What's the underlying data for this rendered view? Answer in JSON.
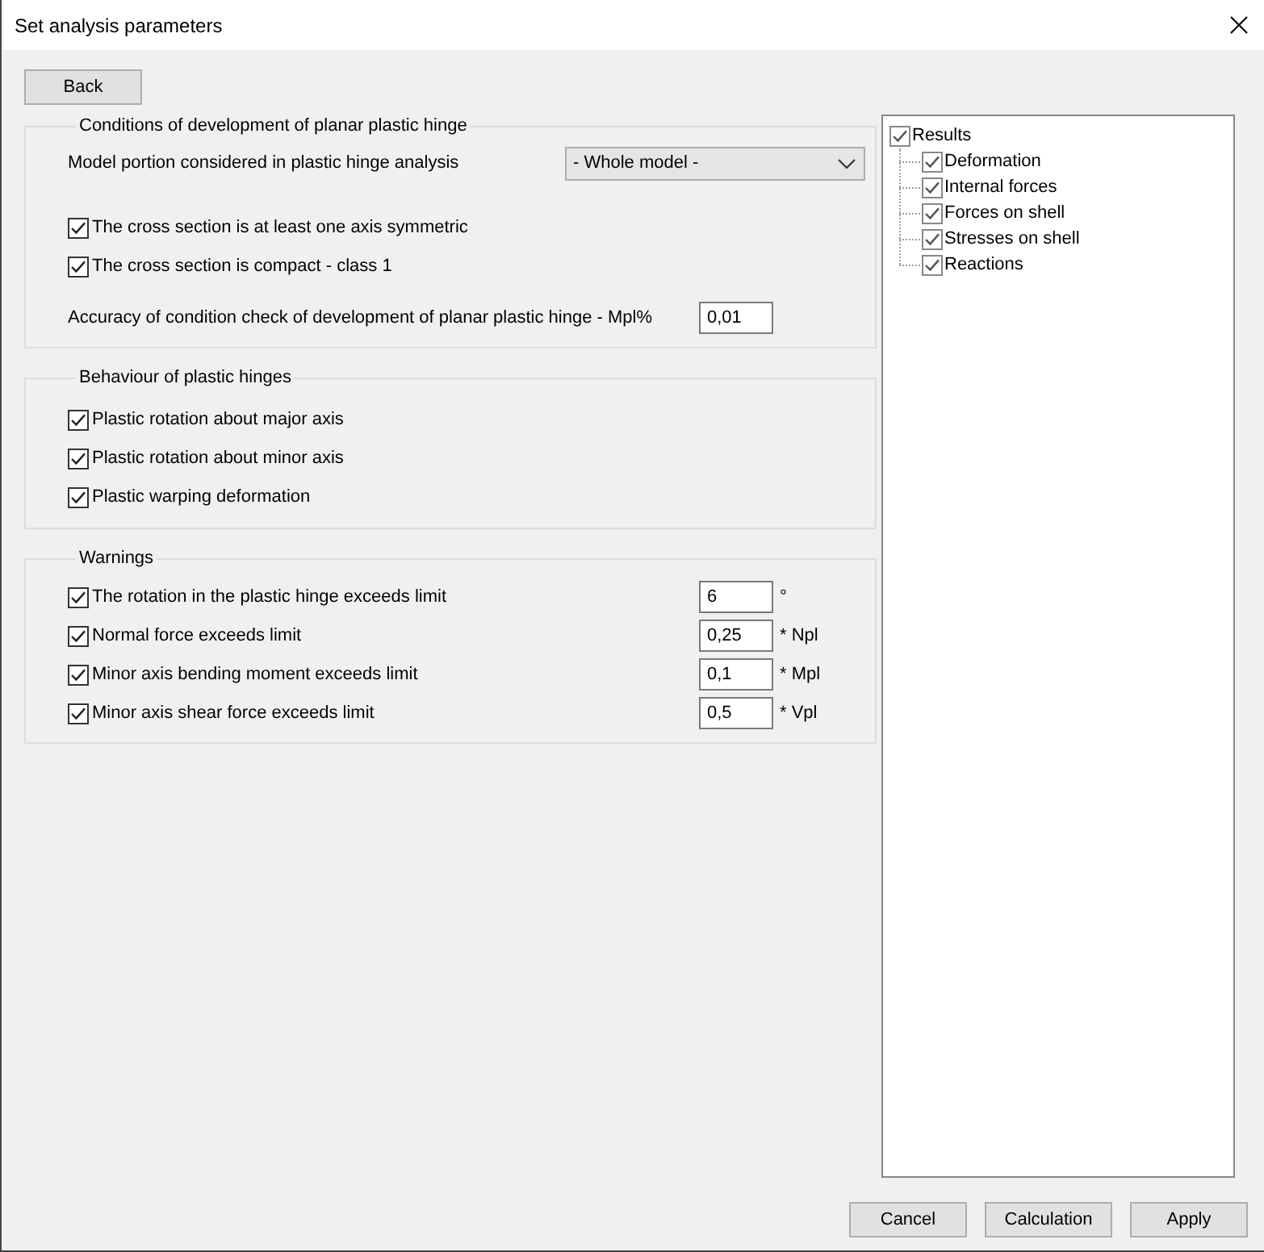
{
  "window": {
    "title": "Set analysis parameters"
  },
  "back_button": "Back",
  "conditions": {
    "title": "Conditions of development of planar plastic hinge",
    "model_portion": {
      "label": "Model portion considered in plastic hinge analysis",
      "value": "- Whole model -"
    },
    "checks": [
      {
        "label": "The cross section is at least one axis symmetric",
        "checked": true
      },
      {
        "label": "The cross section is compact - class 1",
        "checked": true
      }
    ],
    "accuracy": {
      "label": "Accuracy of condition check of development of planar plastic hinge - Mpl%",
      "value": "0,01"
    }
  },
  "behaviour": {
    "title": "Behaviour of plastic hinges",
    "checks": [
      {
        "label": "Plastic rotation about major axis",
        "checked": true
      },
      {
        "label": "Plastic rotation about minor axis",
        "checked": true
      },
      {
        "label": "Plastic warping deformation",
        "checked": true
      }
    ]
  },
  "warnings": {
    "title": "Warnings",
    "rows": [
      {
        "label": "The rotation in the plastic hinge exceeds limit",
        "checked": true,
        "value": "6",
        "unit": "°"
      },
      {
        "label": "Normal force exceeds limit",
        "checked": true,
        "value": "0,25",
        "unit": "* Npl"
      },
      {
        "label": "Minor axis bending moment exceeds limit",
        "checked": true,
        "value": "0,1",
        "unit": "* Mpl"
      },
      {
        "label": "Minor axis shear force exceeds limit",
        "checked": true,
        "value": "0,5",
        "unit": "* Vpl"
      }
    ]
  },
  "results_tree": {
    "label": "Results",
    "checked": true,
    "children": [
      {
        "label": "Deformation",
        "checked": true
      },
      {
        "label": "Internal forces",
        "checked": true
      },
      {
        "label": "Forces on shell",
        "checked": true
      },
      {
        "label": "Stresses on shell",
        "checked": true
      },
      {
        "label": "Reactions",
        "checked": true
      }
    ]
  },
  "buttons": [
    "Cancel",
    "Calculation",
    "Apply"
  ]
}
